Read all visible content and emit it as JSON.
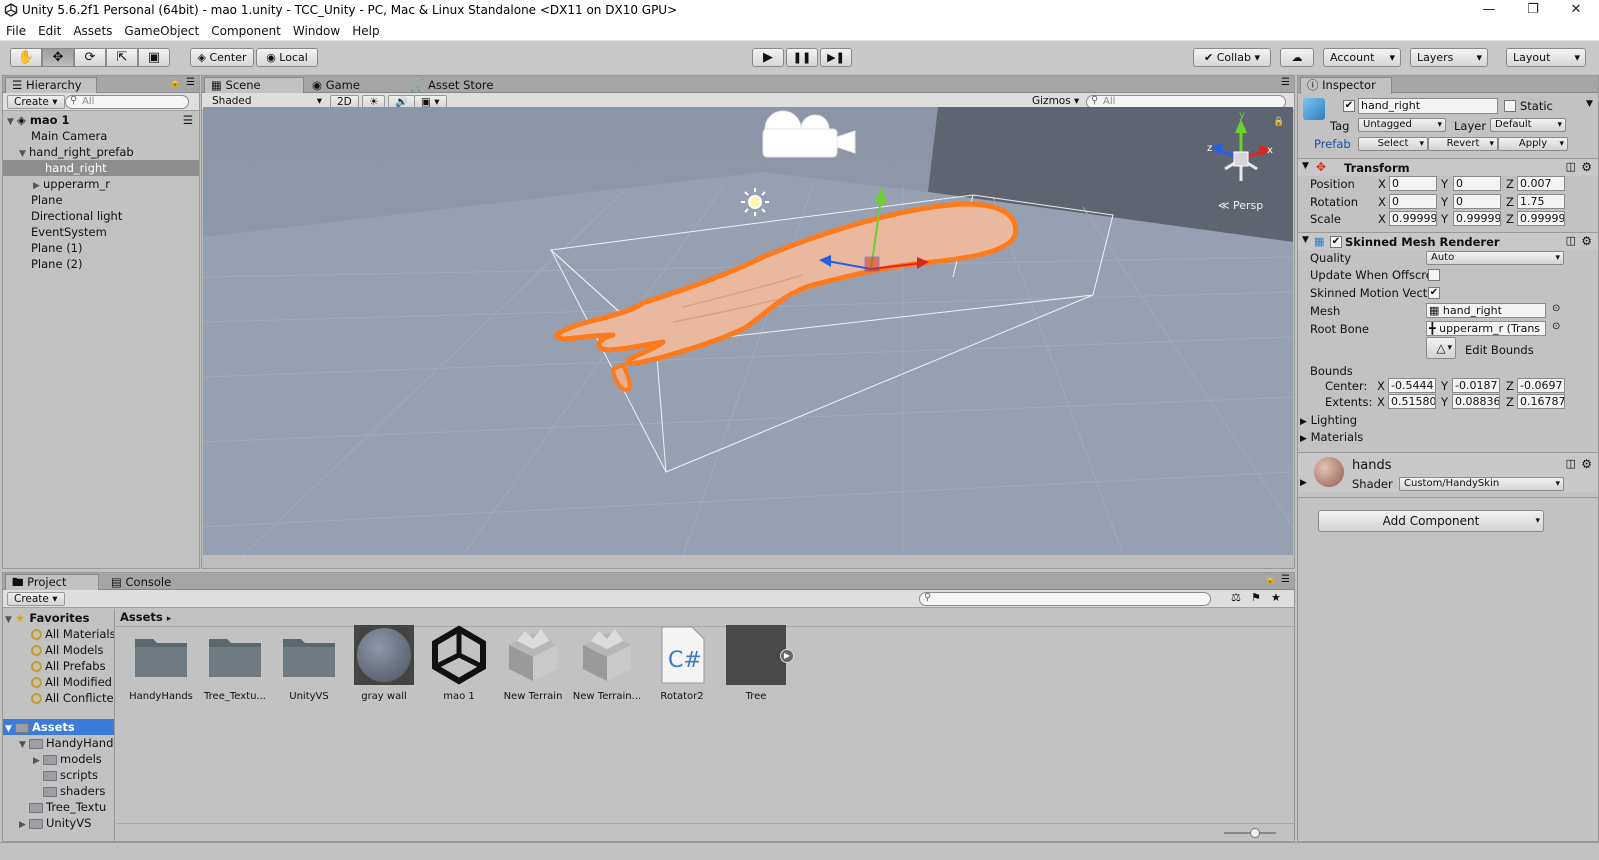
{
  "window": {
    "title": "Unity 5.6.2f1 Personal (64bit) - mao 1.unity - TCC_Unity - PC, Mac & Linux Standalone <DX11 on DX10 GPU>"
  },
  "menu": [
    "File",
    "Edit",
    "Assets",
    "GameObject",
    "Component",
    "Window",
    "Help"
  ],
  "toolbar": {
    "pivot": "Center",
    "space": "Local",
    "collab": "Collab",
    "account": "Account",
    "layers": "Layers",
    "layout": "Layout"
  },
  "hierarchy": {
    "tab": "Hierarchy",
    "create": "Create",
    "search_placeholder": "All",
    "scene": "mao 1",
    "items": [
      "Main Camera",
      "hand_right_prefab",
      "hand_right",
      "upperarm_r",
      "Plane",
      "Directional light",
      "EventSystem",
      "Plane (1)",
      "Plane (2)"
    ]
  },
  "scene": {
    "tabs": [
      "Scene",
      "Game",
      "Asset Store"
    ],
    "shading": "Shaded",
    "mode2d": "2D",
    "gizmos": "Gizmos",
    "search_placeholder": "All",
    "persp": "Persp"
  },
  "inspector": {
    "tab": "Inspector",
    "object_name": "hand_right",
    "static_label": "Static",
    "tag_label": "Tag",
    "tag": "Untagged",
    "layer_label": "Layer",
    "layer": "Default",
    "prefab_label": "Prefab",
    "prefab_select": "Select",
    "prefab_revert": "Revert",
    "prefab_apply": "Apply",
    "transform": {
      "title": "Transform",
      "position_label": "Position",
      "rotation_label": "Rotation",
      "scale_label": "Scale",
      "position": [
        "0",
        "0",
        "0.007"
      ],
      "rotation": [
        "0",
        "0",
        "1.75"
      ],
      "scale": [
        "0.99999",
        "0.99999",
        "0.99999"
      ]
    },
    "smr": {
      "title": "Skinned Mesh Renderer",
      "quality_label": "Quality",
      "quality": "Auto",
      "update_offscreen": "Update When Offscre",
      "skinned_motion": "Skinned Motion Vect",
      "mesh_label": "Mesh",
      "mesh": "hand_right",
      "rootbone_label": "Root Bone",
      "rootbone": "upperarm_r (Trans",
      "edit_bounds": "Edit Bounds",
      "bounds_label": "Bounds",
      "center_label": "Center:",
      "extents_label": "Extents:",
      "center": [
        "-0.5444",
        "-0.0187",
        "-0.0697"
      ],
      "extents": [
        "0.51580",
        "0.08836",
        "0.16787"
      ],
      "lighting": "Lighting",
      "materials": "Materials"
    },
    "material": {
      "name": "hands",
      "shader_label": "Shader",
      "shader": "Custom/HandySkin"
    },
    "add_component": "Add Component",
    "axes": [
      "X",
      "Y",
      "Z"
    ]
  },
  "project": {
    "tabs": [
      "Project",
      "Console"
    ],
    "create": "Create",
    "favorites_title": "Favorites",
    "favorites": [
      "All Materials",
      "All Models",
      "All Prefabs",
      "All Modified",
      "All Conflicte"
    ],
    "assets_root": "Assets",
    "tree": [
      "HandyHand",
      "models",
      "scripts",
      "shaders",
      "Tree_Textu",
      "UnityVS"
    ],
    "breadcrumb": "Assets",
    "assets": [
      "HandyHands",
      "Tree_Textu...",
      "UnityVS",
      "gray wall",
      "mao 1",
      "New Terrain",
      "New Terrain...",
      "Rotator2",
      "Tree"
    ]
  },
  "colors": {
    "selection_outline": "#ff7a1a",
    "skin": "#e9b89e",
    "selected_row": "#3d7bd9"
  }
}
